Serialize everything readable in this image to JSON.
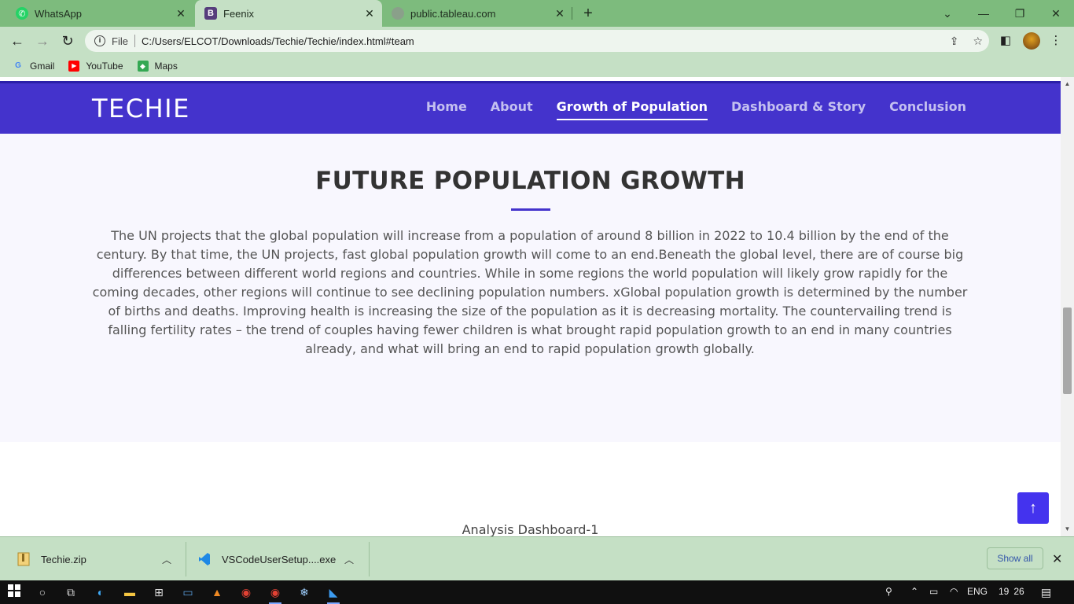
{
  "browser": {
    "tabs": [
      {
        "title": "WhatsApp",
        "icon": "whatsapp-icon"
      },
      {
        "title": "Feenix",
        "icon": "bootstrap-icon",
        "active": true
      },
      {
        "title": "public.tableau.com",
        "icon": "globe-icon"
      }
    ],
    "address": {
      "scheme_label": "File",
      "url": "C:/Users/ELCOT/Downloads/Techie/Techie/index.html#team"
    },
    "bookmarks": [
      {
        "label": "Gmail",
        "icon": "google-icon"
      },
      {
        "label": "YouTube",
        "icon": "youtube-icon"
      },
      {
        "label": "Maps",
        "icon": "maps-icon"
      }
    ]
  },
  "site": {
    "brand": "TECHIE",
    "nav": [
      {
        "label": "Home"
      },
      {
        "label": "About"
      },
      {
        "label": "Growth of Population",
        "active": true
      },
      {
        "label": "Dashboard & Story"
      },
      {
        "label": "Conclusion"
      }
    ],
    "section": {
      "heading": "FUTURE POPULATION GROWTH",
      "body": "The UN projects that the global population will increase from a population of around 8 billion in 2022 to 10.4 billion by the end of the century. By that time, the UN projects, fast global population growth will come to an end.Beneath the global level, there are of course big differences between different world regions and countries. While in some regions the world population will likely grow rapidly for the coming decades, other regions will continue to see declining population numbers. xGlobal population growth is determined by the number of births and deaths. Improving health is increasing the size of the population as it is decreasing mortality. The countervailing trend is falling fertility rates – the trend of couples having fewer children is what brought rapid population growth to an end in many countries already, and what will bring an end to rapid population growth globally."
    },
    "dashboard_title": "Analysis Dashboard-1"
  },
  "downloads": [
    {
      "name": "Techie.zip",
      "icon": "zip-icon"
    },
    {
      "name": "VSCodeUserSetup....exe",
      "icon": "vscode-icon"
    }
  ],
  "downloads_show_all": "Show all",
  "taskbar": {
    "language": "ENG",
    "time": "19 26"
  },
  "colors": {
    "navbar": "#4433cc",
    "accent": "#4433ee",
    "browser_frame": "#7dbb7d"
  }
}
